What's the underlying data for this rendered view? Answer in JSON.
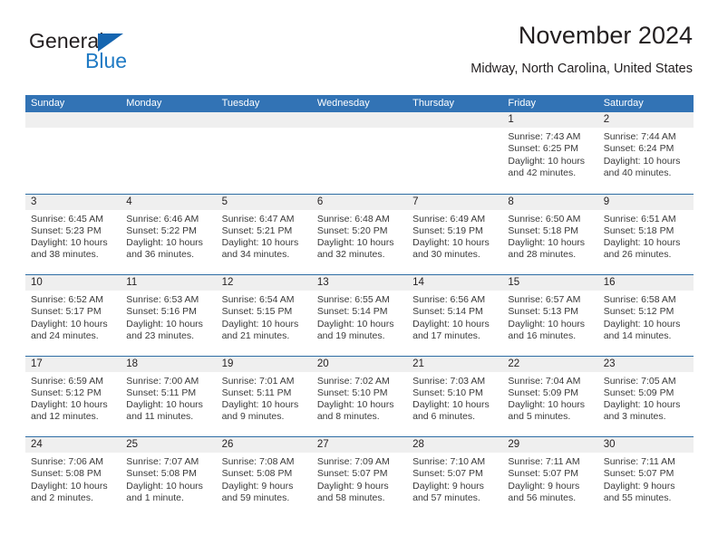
{
  "logo": {
    "word1": "General",
    "word2": "Blue",
    "triangle_color": "#1565b0",
    "blue_color": "#1f7ac4"
  },
  "header": {
    "title": "November 2024",
    "subtitle": "Midway, North Carolina, United States"
  },
  "theme": {
    "header_blue": "#3273b5",
    "separator_blue": "#2e6da4",
    "day_band_gray": "#efefef",
    "text": "#231f20"
  },
  "calendar": {
    "weekdays": [
      "Sunday",
      "Monday",
      "Tuesday",
      "Wednesday",
      "Thursday",
      "Friday",
      "Saturday"
    ],
    "weeks": [
      [
        {
          "empty": true
        },
        {
          "empty": true
        },
        {
          "empty": true
        },
        {
          "empty": true
        },
        {
          "empty": true
        },
        {
          "day": "1",
          "sunrise": "Sunrise: 7:43 AM",
          "sunset": "Sunset: 6:25 PM",
          "daylight1": "Daylight: 10 hours",
          "daylight2": "and 42 minutes."
        },
        {
          "day": "2",
          "sunrise": "Sunrise: 7:44 AM",
          "sunset": "Sunset: 6:24 PM",
          "daylight1": "Daylight: 10 hours",
          "daylight2": "and 40 minutes."
        }
      ],
      [
        {
          "day": "3",
          "sunrise": "Sunrise: 6:45 AM",
          "sunset": "Sunset: 5:23 PM",
          "daylight1": "Daylight: 10 hours",
          "daylight2": "and 38 minutes."
        },
        {
          "day": "4",
          "sunrise": "Sunrise: 6:46 AM",
          "sunset": "Sunset: 5:22 PM",
          "daylight1": "Daylight: 10 hours",
          "daylight2": "and 36 minutes."
        },
        {
          "day": "5",
          "sunrise": "Sunrise: 6:47 AM",
          "sunset": "Sunset: 5:21 PM",
          "daylight1": "Daylight: 10 hours",
          "daylight2": "and 34 minutes."
        },
        {
          "day": "6",
          "sunrise": "Sunrise: 6:48 AM",
          "sunset": "Sunset: 5:20 PM",
          "daylight1": "Daylight: 10 hours",
          "daylight2": "and 32 minutes."
        },
        {
          "day": "7",
          "sunrise": "Sunrise: 6:49 AM",
          "sunset": "Sunset: 5:19 PM",
          "daylight1": "Daylight: 10 hours",
          "daylight2": "and 30 minutes."
        },
        {
          "day": "8",
          "sunrise": "Sunrise: 6:50 AM",
          "sunset": "Sunset: 5:18 PM",
          "daylight1": "Daylight: 10 hours",
          "daylight2": "and 28 minutes."
        },
        {
          "day": "9",
          "sunrise": "Sunrise: 6:51 AM",
          "sunset": "Sunset: 5:18 PM",
          "daylight1": "Daylight: 10 hours",
          "daylight2": "and 26 minutes."
        }
      ],
      [
        {
          "day": "10",
          "sunrise": "Sunrise: 6:52 AM",
          "sunset": "Sunset: 5:17 PM",
          "daylight1": "Daylight: 10 hours",
          "daylight2": "and 24 minutes."
        },
        {
          "day": "11",
          "sunrise": "Sunrise: 6:53 AM",
          "sunset": "Sunset: 5:16 PM",
          "daylight1": "Daylight: 10 hours",
          "daylight2": "and 23 minutes."
        },
        {
          "day": "12",
          "sunrise": "Sunrise: 6:54 AM",
          "sunset": "Sunset: 5:15 PM",
          "daylight1": "Daylight: 10 hours",
          "daylight2": "and 21 minutes."
        },
        {
          "day": "13",
          "sunrise": "Sunrise: 6:55 AM",
          "sunset": "Sunset: 5:14 PM",
          "daylight1": "Daylight: 10 hours",
          "daylight2": "and 19 minutes."
        },
        {
          "day": "14",
          "sunrise": "Sunrise: 6:56 AM",
          "sunset": "Sunset: 5:14 PM",
          "daylight1": "Daylight: 10 hours",
          "daylight2": "and 17 minutes."
        },
        {
          "day": "15",
          "sunrise": "Sunrise: 6:57 AM",
          "sunset": "Sunset: 5:13 PM",
          "daylight1": "Daylight: 10 hours",
          "daylight2": "and 16 minutes."
        },
        {
          "day": "16",
          "sunrise": "Sunrise: 6:58 AM",
          "sunset": "Sunset: 5:12 PM",
          "daylight1": "Daylight: 10 hours",
          "daylight2": "and 14 minutes."
        }
      ],
      [
        {
          "day": "17",
          "sunrise": "Sunrise: 6:59 AM",
          "sunset": "Sunset: 5:12 PM",
          "daylight1": "Daylight: 10 hours",
          "daylight2": "and 12 minutes."
        },
        {
          "day": "18",
          "sunrise": "Sunrise: 7:00 AM",
          "sunset": "Sunset: 5:11 PM",
          "daylight1": "Daylight: 10 hours",
          "daylight2": "and 11 minutes."
        },
        {
          "day": "19",
          "sunrise": "Sunrise: 7:01 AM",
          "sunset": "Sunset: 5:11 PM",
          "daylight1": "Daylight: 10 hours",
          "daylight2": "and 9 minutes."
        },
        {
          "day": "20",
          "sunrise": "Sunrise: 7:02 AM",
          "sunset": "Sunset: 5:10 PM",
          "daylight1": "Daylight: 10 hours",
          "daylight2": "and 8 minutes."
        },
        {
          "day": "21",
          "sunrise": "Sunrise: 7:03 AM",
          "sunset": "Sunset: 5:10 PM",
          "daylight1": "Daylight: 10 hours",
          "daylight2": "and 6 minutes."
        },
        {
          "day": "22",
          "sunrise": "Sunrise: 7:04 AM",
          "sunset": "Sunset: 5:09 PM",
          "daylight1": "Daylight: 10 hours",
          "daylight2": "and 5 minutes."
        },
        {
          "day": "23",
          "sunrise": "Sunrise: 7:05 AM",
          "sunset": "Sunset: 5:09 PM",
          "daylight1": "Daylight: 10 hours",
          "daylight2": "and 3 minutes."
        }
      ],
      [
        {
          "day": "24",
          "sunrise": "Sunrise: 7:06 AM",
          "sunset": "Sunset: 5:08 PM",
          "daylight1": "Daylight: 10 hours",
          "daylight2": "and 2 minutes."
        },
        {
          "day": "25",
          "sunrise": "Sunrise: 7:07 AM",
          "sunset": "Sunset: 5:08 PM",
          "daylight1": "Daylight: 10 hours",
          "daylight2": "and 1 minute."
        },
        {
          "day": "26",
          "sunrise": "Sunrise: 7:08 AM",
          "sunset": "Sunset: 5:08 PM",
          "daylight1": "Daylight: 9 hours",
          "daylight2": "and 59 minutes."
        },
        {
          "day": "27",
          "sunrise": "Sunrise: 7:09 AM",
          "sunset": "Sunset: 5:07 PM",
          "daylight1": "Daylight: 9 hours",
          "daylight2": "and 58 minutes."
        },
        {
          "day": "28",
          "sunrise": "Sunrise: 7:10 AM",
          "sunset": "Sunset: 5:07 PM",
          "daylight1": "Daylight: 9 hours",
          "daylight2": "and 57 minutes."
        },
        {
          "day": "29",
          "sunrise": "Sunrise: 7:11 AM",
          "sunset": "Sunset: 5:07 PM",
          "daylight1": "Daylight: 9 hours",
          "daylight2": "and 56 minutes."
        },
        {
          "day": "30",
          "sunrise": "Sunrise: 7:11 AM",
          "sunset": "Sunset: 5:07 PM",
          "daylight1": "Daylight: 9 hours",
          "daylight2": "and 55 minutes."
        }
      ]
    ]
  }
}
